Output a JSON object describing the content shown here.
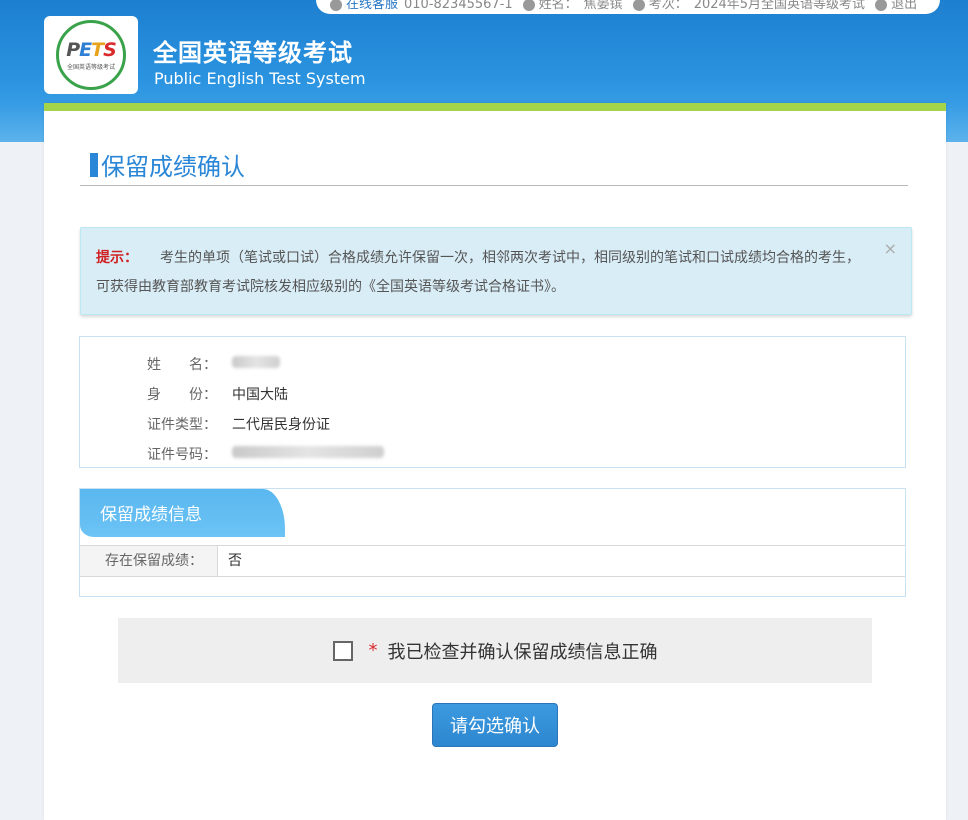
{
  "topbar": {
    "service_label": "在线客服",
    "phone": "010-82345567-1",
    "name_label": "姓名：",
    "name_value": "焦晏镔",
    "exam_label": "考次：",
    "exam_value": "2024年5月全国英语等级考试",
    "logout_label": "退出"
  },
  "header": {
    "title": "全国英语等级考试",
    "subtitle": "Public English Test System",
    "logo": {
      "letters": [
        "P",
        "E",
        "T",
        "S"
      ],
      "caption": "全国英语等级考试"
    }
  },
  "page": {
    "title": "保留成绩确认"
  },
  "alert": {
    "label": "提示：",
    "text": "考生的单项（笔试或口试）合格成绩允许保留一次，相邻两次考试中，相同级别的笔试和口试成绩均合格的考生，可获得由教育部教育考试院核发相应级别的《全国英语等级考试合格证书》。",
    "close_glyph": "×"
  },
  "info": {
    "rows": [
      {
        "label": "姓　　名：",
        "value": ""
      },
      {
        "label": "身　　份：",
        "value": "中国大陆"
      },
      {
        "label": "证件类型：",
        "value": "二代居民身份证"
      },
      {
        "label": "证件号码：",
        "value": ""
      }
    ]
  },
  "score": {
    "section_title": "保留成绩信息",
    "row_label": "存在保留成绩：",
    "row_value": "否"
  },
  "confirm": {
    "asterisk": "*",
    "text": "我已检查并确认保留成绩信息正确",
    "button_label": "请勾选确认"
  },
  "colors": {
    "header_blue": "#2a93e0",
    "accent_green": "#a3d44a",
    "title_blue": "#2a86d6",
    "alert_bg": "#d9edf7",
    "alert_label_red": "#d02020"
  }
}
